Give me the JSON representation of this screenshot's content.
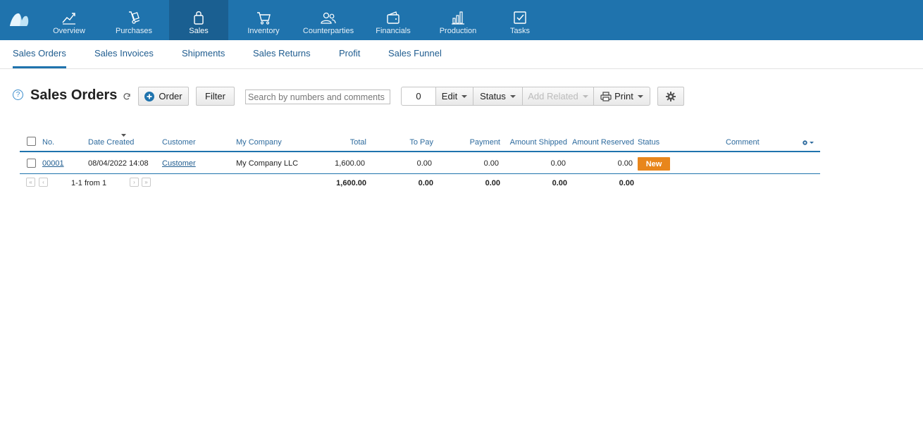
{
  "nav": {
    "items": [
      {
        "label": "Overview",
        "icon": "chart-line-icon"
      },
      {
        "label": "Purchases",
        "icon": "hand-truck-icon"
      },
      {
        "label": "Sales",
        "icon": "shopping-bag-icon"
      },
      {
        "label": "Inventory",
        "icon": "cart-icon"
      },
      {
        "label": "Counterparties",
        "icon": "people-icon"
      },
      {
        "label": "Financials",
        "icon": "wallet-icon"
      },
      {
        "label": "Production",
        "icon": "bar-chart-icon"
      },
      {
        "label": "Tasks",
        "icon": "checkbox-icon"
      }
    ],
    "active": "Sales"
  },
  "subnav": {
    "tabs": [
      "Sales Orders",
      "Sales Invoices",
      "Shipments",
      "Sales Returns",
      "Profit",
      "Sales Funnel"
    ],
    "active": "Sales Orders"
  },
  "toolbar": {
    "title": "Sales Orders",
    "help": "?",
    "order_button": "Order",
    "filter_button": "Filter",
    "search_placeholder": "Search by numbers and comments",
    "selected_count": "0",
    "edit_button": "Edit",
    "status_button": "Status",
    "add_related_button": "Add Related",
    "print_button": "Print"
  },
  "table": {
    "columns": [
      "No.",
      "Date Created",
      "Customer",
      "My Company",
      "Total",
      "To Pay",
      "Payment",
      "Amount Shipped",
      "Amount Reserved",
      "Status",
      "Comment"
    ],
    "rows": [
      {
        "no": "00001",
        "date": "08/04/2022 14:08",
        "customer": "Customer",
        "company": "My Company LLC",
        "total": "1,600.00",
        "to_pay": "0.00",
        "payment": "0.00",
        "shipped": "0.00",
        "reserved": "0.00",
        "status": "New",
        "comment": ""
      }
    ],
    "footer": {
      "pagination": "1-1 from 1",
      "total": "1,600.00",
      "to_pay": "0.00",
      "payment": "0.00",
      "shipped": "0.00",
      "reserved": "0.00"
    }
  },
  "colors": {
    "topbar": "#1f73ad",
    "topbar_active": "#1a5f91",
    "status_new": "#e8861c",
    "link": "#1f5c8f"
  }
}
